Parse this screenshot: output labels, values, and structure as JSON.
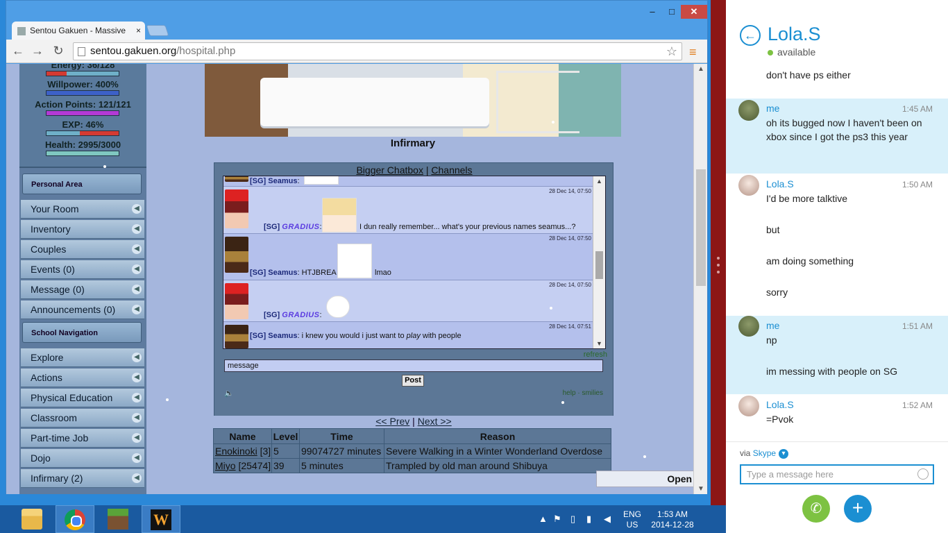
{
  "browser": {
    "tab_title": "Sentou Gakuen - Massive",
    "tab_close": "×",
    "url_host": "sentou.gakuen.org",
    "url_path": "/hospital.php",
    "btn_back": "←",
    "btn_forward": "→",
    "btn_reload": "↻",
    "btn_star": "☆",
    "btn_menu": "≡",
    "win_min": "–",
    "win_max": "□",
    "win_close": "✕"
  },
  "stats": {
    "energy_label": "Energy: 36/128",
    "energy_fraction": 0.28,
    "willpower_label": "Willpower: 400%",
    "willpower_fraction": 1.0,
    "ap_label": "Action Points: 121/121",
    "ap_fraction": 1.0,
    "exp_label": "EXP: 46%",
    "exp_fraction": 0.46,
    "health_label": "Health: 2995/3000",
    "health_fraction": 0.998
  },
  "sidebar": {
    "personal_header": "Personal Area",
    "personal_items": [
      "Your Room",
      "Inventory",
      "Couples",
      "Events (0)",
      "Message (0)",
      "Announcements (0)"
    ],
    "school_header": "School Navigation",
    "school_items": [
      "Explore",
      "Actions",
      "Physical Education",
      "Classroom",
      "Part-time Job",
      "Dojo",
      "Infirmary (2)"
    ]
  },
  "page": {
    "heading": "Infirmary",
    "open_chat": "Open School Chat"
  },
  "chat": {
    "link_bigger": "Bigger Chatbox",
    "link_sep": "|",
    "link_channels": "Channels",
    "messages": [
      {
        "tag": "[SG]",
        "user": "Seamus",
        "sep": ":",
        "text": "",
        "time": ""
      },
      {
        "tag": "[SG]",
        "user": "GRADIUS",
        "sep": ":",
        "text": "I dun really remember... what's your previous names seamus...?",
        "time": "28 Dec 14, 07:50"
      },
      {
        "tag": "[SG]",
        "user": "Seamus",
        "sep": ":",
        "text": "HTJBREA",
        "text_after": "lmao",
        "time": "28 Dec 14, 07:50"
      },
      {
        "tag": "[SG]",
        "user": "GRADIUS",
        "sep": ":",
        "text": "",
        "time": "28 Dec 14, 07:50"
      },
      {
        "tag": "[SG]",
        "user": "Seamus",
        "sep": ":",
        "text": "i knew you would i just want to",
        "text_em": "play",
        "text_after": "with people",
        "time": "28 Dec 14, 07:51"
      }
    ],
    "refresh": "refresh",
    "message_value": "message",
    "post_label": "Post",
    "sound_icon": "🔈",
    "help": "help",
    "help_sep": "·",
    "smilies": "smilies",
    "prev": "<< Prev",
    "pager_sep": "|",
    "next": "Next >>"
  },
  "hospital_table": {
    "headers": [
      "Name",
      "Level",
      "Time",
      "Reason"
    ],
    "rows": [
      {
        "name": "Enokinoki",
        "id": "[3]",
        "level": "5",
        "time": "99074727 minutes",
        "reason": "Severe Walking in a Winter Wonderland Overdose"
      },
      {
        "name": "Miyo",
        "id": "[25474]",
        "level": "39",
        "time": "5 minutes",
        "reason": "Trampled by old man around Shibuya"
      }
    ]
  },
  "taskbar": {
    "apps": [
      "file-explorer",
      "chrome",
      "minecraft",
      "w-app"
    ],
    "lang_top": "ENG",
    "lang_bottom": "US",
    "time": "1:53 AM",
    "date": "2014-12-28"
  },
  "skype": {
    "contact_name": "Lola.S",
    "status": "available",
    "partial_top": "don't have ps either",
    "messages": [
      {
        "from": "me",
        "time": "1:45 AM",
        "lines": [
          "oh its bugged now I haven't been on xbox since I got the ps3 this year"
        ]
      },
      {
        "from": "Lola.S",
        "time": "1:50 AM",
        "lines": [
          "I'd be more talktive",
          "but",
          "am doing something",
          "sorry"
        ]
      },
      {
        "from": "me",
        "time": "1:51 AM",
        "lines": [
          "np",
          "im messing with people on SG"
        ]
      },
      {
        "from": "Lola.S",
        "time": "1:52 AM",
        "lines": [
          "=Pvok"
        ]
      }
    ],
    "via_prefix": "via",
    "via_service": "Skype",
    "input_placeholder": "Type a message here",
    "colors": {
      "accent": "#1b8fd2",
      "call": "#7dc242",
      "me_bg": "#d8f0fa"
    }
  }
}
